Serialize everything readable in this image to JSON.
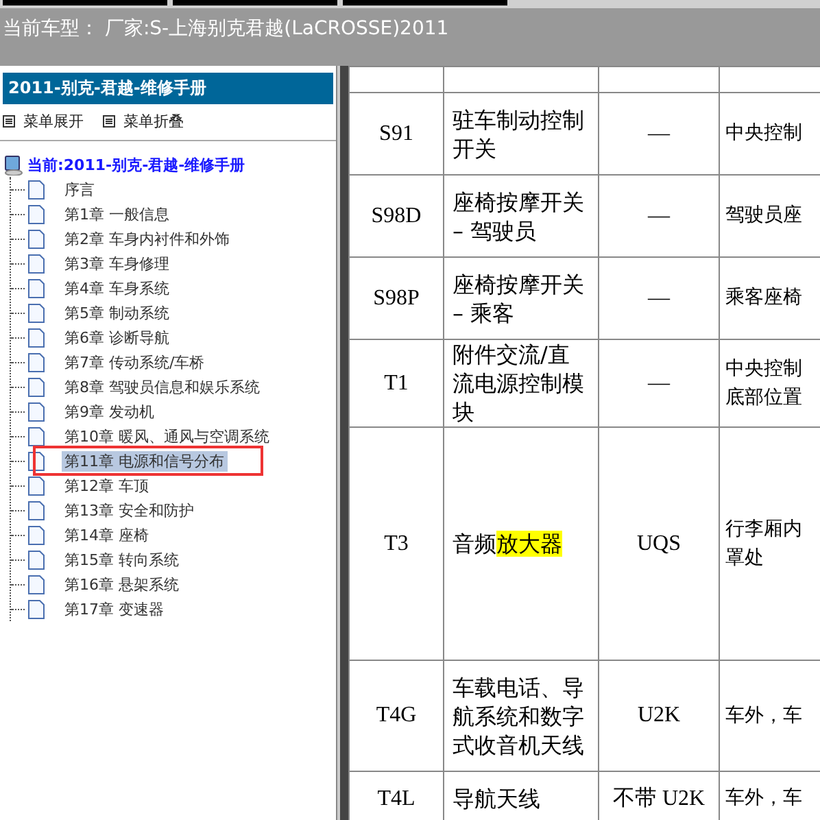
{
  "header": {
    "title": "当前车型： 厂家:S-上海别克君越(LaCROSSE)2011"
  },
  "sidebar": {
    "title": "2011-别克-君越-维修手册",
    "menu_buttons": [
      "菜单展开",
      "菜单折叠"
    ],
    "tree": {
      "label": "当前:2011-别克-君越-维修手册",
      "children": [
        {
          "label": "序言",
          "selected": false
        },
        {
          "label": "第1章 一般信息",
          "selected": false
        },
        {
          "label": "第2章 车身内衬件和外饰",
          "selected": false
        },
        {
          "label": "第3章 车身修理",
          "selected": false
        },
        {
          "label": "第4章 车身系统",
          "selected": false
        },
        {
          "label": "第5章 制动系统",
          "selected": false
        },
        {
          "label": "第6章 诊断导航",
          "selected": false
        },
        {
          "label": "第7章 传动系统/车桥",
          "selected": false
        },
        {
          "label": "第8章 驾驶员信息和娱乐系统",
          "selected": false
        },
        {
          "label": "第9章 发动机",
          "selected": false
        },
        {
          "label": "第10章 暖风、通风与空调系统",
          "selected": false
        },
        {
          "label": "第11章 电源和信号分布",
          "selected": true
        },
        {
          "label": "第12章 车顶",
          "selected": false
        },
        {
          "label": "第13章 安全和防护",
          "selected": false
        },
        {
          "label": "第14章 座椅",
          "selected": false
        },
        {
          "label": "第15章 转向系统",
          "selected": false
        },
        {
          "label": "第16章 悬架系统",
          "selected": false
        },
        {
          "label": "第17章 变速器",
          "selected": false
        }
      ]
    }
  },
  "table": {
    "rows": [
      {
        "code": "",
        "name": [],
        "option": "",
        "location": []
      },
      {
        "code": "S91",
        "name": [
          {
            "text": "驻车制动控制开关",
            "highlighted": false
          }
        ],
        "option": "—",
        "location": [
          "中央控制"
        ]
      },
      {
        "code": "S98D",
        "name": [
          {
            "text": "座椅按摩开关 – 驾驶员",
            "highlighted": false
          }
        ],
        "option": "—",
        "location": [
          "驾驶员座"
        ]
      },
      {
        "code": "S98P",
        "name": [
          {
            "text": "座椅按摩开关 – 乘客",
            "highlighted": false
          }
        ],
        "option": "—",
        "location": [
          "乘客座椅"
        ]
      },
      {
        "code": "T1",
        "name": [
          {
            "text": "附件交流/直流电源控制模块",
            "highlighted": false
          }
        ],
        "option": "—",
        "location": [
          "中央控制",
          "底部位置"
        ]
      },
      {
        "code": "T3",
        "name": [
          {
            "text": "音频",
            "highlighted": false
          },
          {
            "text": "放大器",
            "highlighted": true
          }
        ],
        "option": "UQS",
        "location": [
          "行李厢内",
          "罩处"
        ]
      },
      {
        "code": "T4G",
        "name": [
          {
            "text": "车载电话、导航系统和数字式收音机天线",
            "highlighted": false
          }
        ],
        "option": "U2K",
        "location": [
          "车外，车"
        ]
      },
      {
        "code": "T4L",
        "name": [
          {
            "text": "导航天线",
            "highlighted": false
          }
        ],
        "option": "不带 U2K",
        "location": [
          "车外，车"
        ]
      }
    ]
  }
}
